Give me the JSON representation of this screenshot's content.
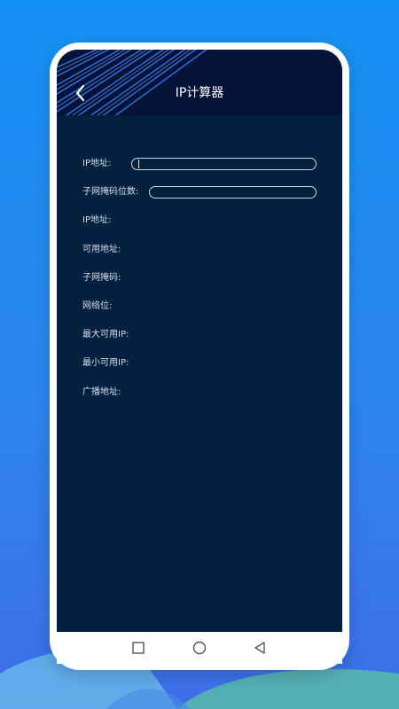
{
  "header": {
    "title": "IP计算器",
    "back_icon": "chevron-left-icon"
  },
  "form": {
    "ip_input_label": "IP地址:",
    "ip_input_value": "",
    "mask_bits_label": "子网掩码位数:",
    "mask_bits_value": ""
  },
  "results": {
    "ip_address_label": "IP地址:",
    "usable_address_label": "可用地址:",
    "subnet_mask_label": "子网掩码:",
    "network_bits_label": "网络位:",
    "max_usable_ip_label": "最大可用IP:",
    "min_usable_ip_label": "最小可用IP:",
    "broadcast_label": "广播地址:"
  },
  "navbar": {
    "recents_icon": "square-icon",
    "home_icon": "circle-icon",
    "back_icon": "triangle-left-icon"
  },
  "colors": {
    "background_top": "#1590f3",
    "screen_bg": "#03213f",
    "header_bg": "#061338",
    "text": "#d6dde8"
  }
}
